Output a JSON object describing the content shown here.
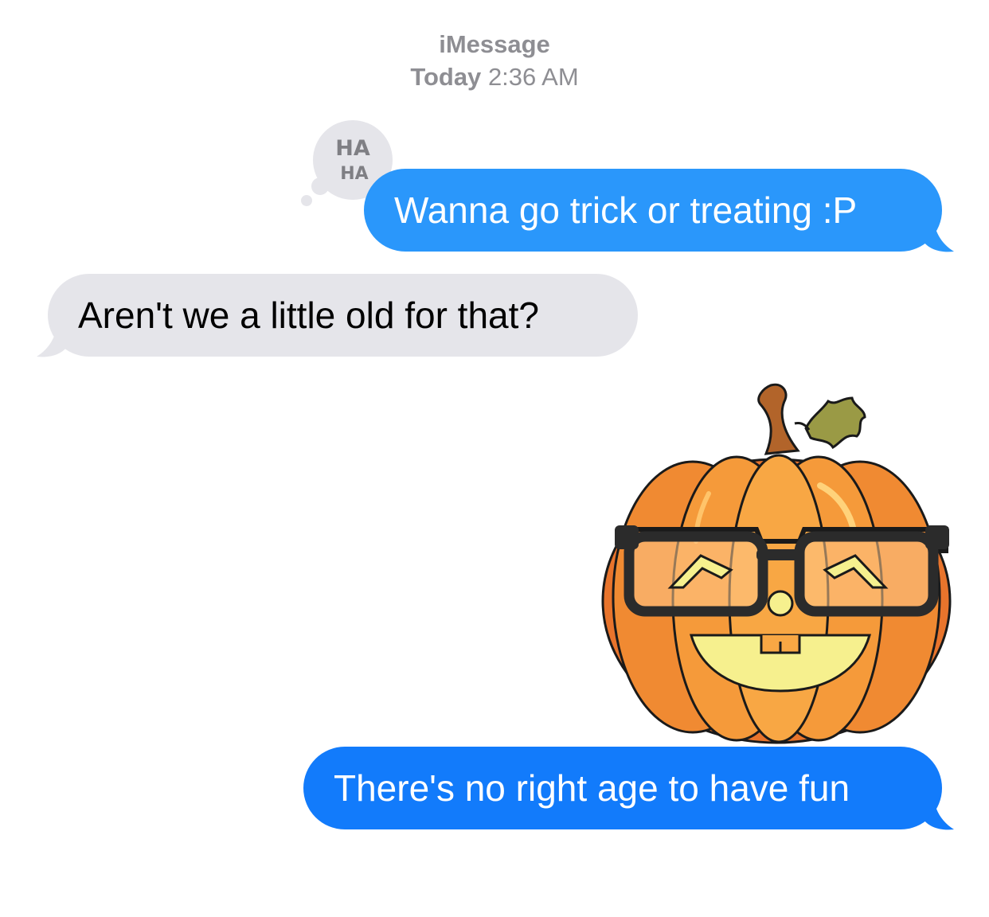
{
  "header": {
    "service": "iMessage",
    "day": "Today",
    "time": "2:36 AM"
  },
  "messages": [
    {
      "direction": "sent",
      "text": "Wanna go trick or treating :P",
      "color": "#2a97fb",
      "tapback": {
        "icon": "haha-icon",
        "lines": [
          "HA",
          "HA"
        ]
      }
    },
    {
      "direction": "received",
      "text": "Aren't we a little old for that?",
      "color": "#e5e5ea"
    },
    {
      "direction": "sent",
      "type": "sticker",
      "icon": "pumpkin-with-glasses-icon"
    },
    {
      "direction": "sent",
      "text": "There's no right age to have fun",
      "color": "#127bfb"
    }
  ]
}
